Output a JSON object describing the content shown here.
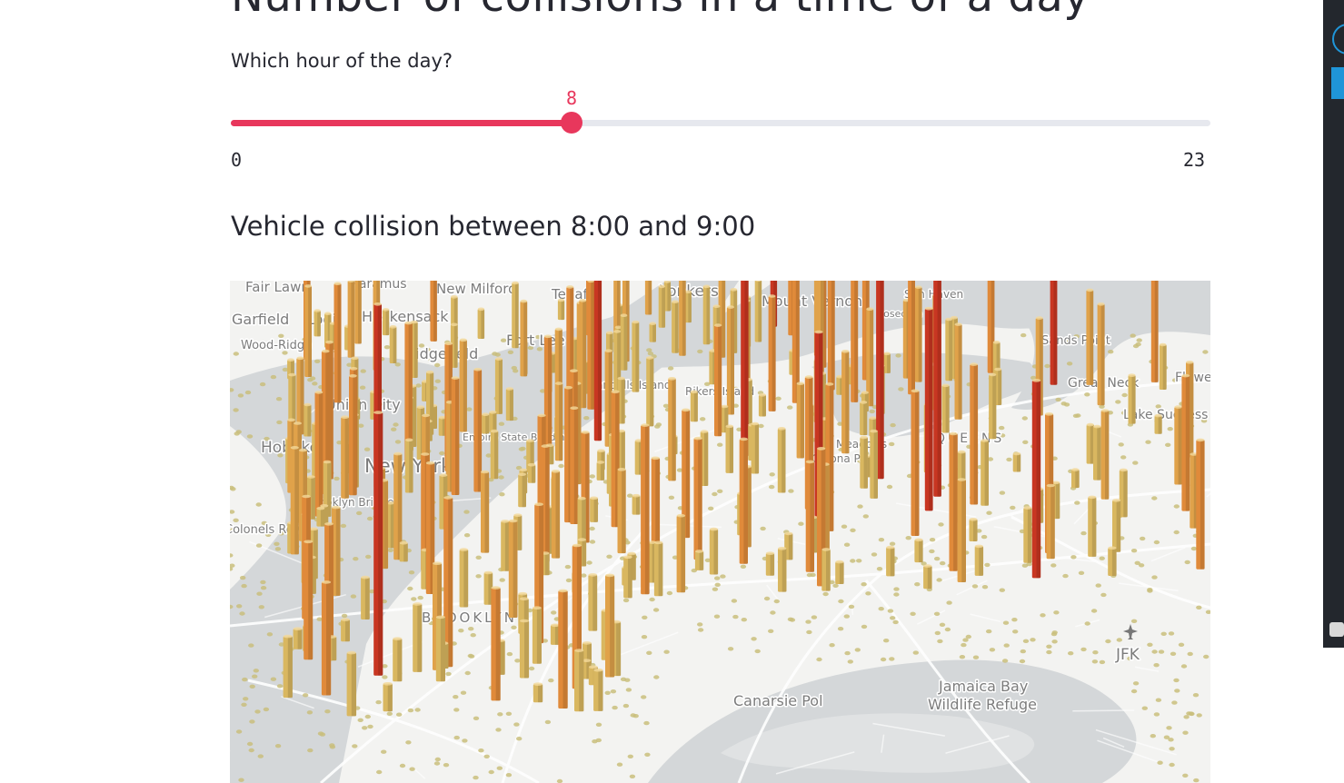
{
  "page": {
    "title": "Number of collisions in a time of a day",
    "slider_label": "Which hour of the day?",
    "subheader": "Vehicle collision between 8:00 and 9:00"
  },
  "slider": {
    "min": 0,
    "max": 23,
    "value": 8,
    "min_label": "0",
    "max_label": "23",
    "value_label": "8",
    "color": "#e8375c",
    "track_color": "#e6e8ee"
  },
  "map": {
    "labels": [
      {
        "key": "fair_lawn",
        "text": "Fair Lawn"
      },
      {
        "key": "paramus",
        "text": "Paramus"
      },
      {
        "key": "new_milford",
        "text": "New Milford"
      },
      {
        "key": "tenafly",
        "text": "Tenafly"
      },
      {
        "key": "yonkers",
        "text": "Yonkers"
      },
      {
        "key": "mount_vernon",
        "text": "Mount Vernon"
      },
      {
        "key": "sun_haven",
        "text": "Sun Haven"
      },
      {
        "key": "rosedale",
        "text": "Rosedale"
      },
      {
        "key": "garfield",
        "text": "Garfield"
      },
      {
        "key": "lodi",
        "text": "Lodi"
      },
      {
        "key": "hackensack",
        "text": "Hackensack"
      },
      {
        "key": "wood_ridge",
        "text": "Wood-Ridge"
      },
      {
        "key": "ridgefield",
        "text": "Ridgefield"
      },
      {
        "key": "fort_lee",
        "text": "Fort Lee"
      },
      {
        "key": "sands_point",
        "text": "Sands Point"
      },
      {
        "key": "flower",
        "text": "Flowe"
      },
      {
        "key": "great_neck",
        "text": "Great Neck"
      },
      {
        "key": "lake_success",
        "text": "Lake Success"
      },
      {
        "key": "rikers",
        "text": "Rikers Island"
      },
      {
        "key": "randalls",
        "text": "Randalls Island"
      },
      {
        "key": "union_city",
        "text": "Union City"
      },
      {
        "key": "hoboken",
        "text": "Hoboken"
      },
      {
        "key": "new_york",
        "text": "New York"
      },
      {
        "key": "brooklyn_bridge",
        "text": "Brooklyn Bridge"
      },
      {
        "key": "colonels",
        "text": "Colonels Row"
      },
      {
        "key": "meadows",
        "text": "Meadows"
      },
      {
        "key": "corona_park",
        "text": "Corona Park"
      },
      {
        "key": "queens",
        "text": "QUEENS"
      },
      {
        "key": "brooklyn",
        "text": "BROOKLYN"
      },
      {
        "key": "canarsie",
        "text": "Canarsie Pol"
      },
      {
        "key": "jamaica_bay",
        "text": "Jamaica Bay"
      },
      {
        "key": "wildlife_refuge",
        "text": "Wildlife Refuge"
      },
      {
        "key": "jfk",
        "text": "JFK"
      },
      {
        "key": "empire_state",
        "text": "Empire State Building"
      }
    ]
  },
  "colors": {
    "accent": "#e8375c",
    "water": "#d4d7d9",
    "land": "#f3f3f1",
    "hex_dot": "#c9be7c",
    "col_low": "#d9b760",
    "col_mid": "#e08a3a",
    "col_high": "#c83622"
  }
}
